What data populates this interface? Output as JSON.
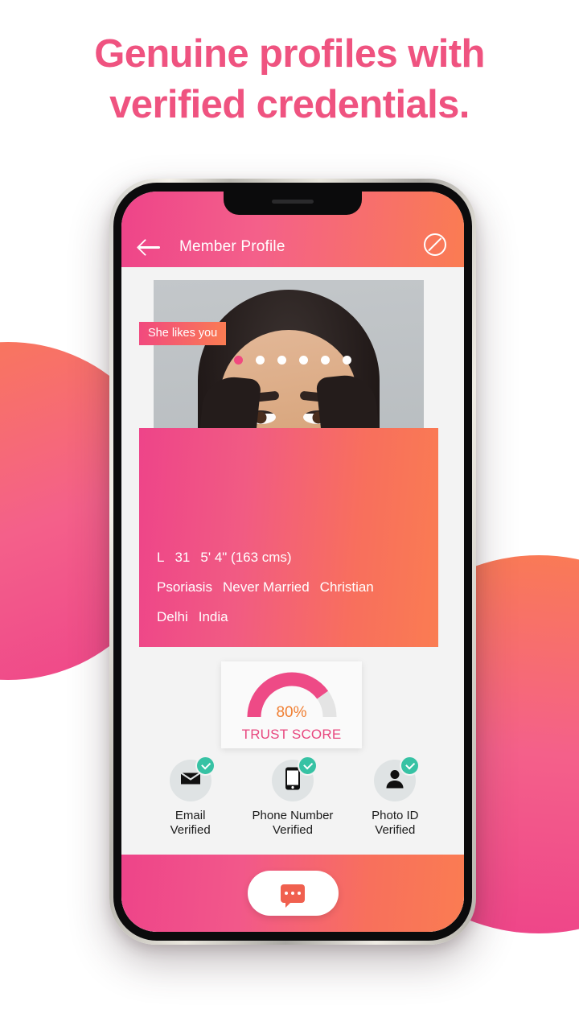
{
  "headline": {
    "line1": "Genuine profiles with",
    "line2": "verified credentials.",
    "color": "#EF5380"
  },
  "app": {
    "header": {
      "back_icon": "back-arrow-icon",
      "title": "Member Profile",
      "block_icon": "block-icon"
    },
    "photo": {
      "likes_badge": "She likes you",
      "dot_count": 6,
      "active_dot_index": 0
    },
    "profile": {
      "line1": {
        "id": "L",
        "age": "31",
        "height": "5' 4\" (163 cms)"
      },
      "line2": {
        "condition": "Psoriasis",
        "marital_status": "Never Married",
        "religion": "Christian"
      },
      "line3": {
        "city": "Delhi",
        "country": "India"
      }
    },
    "trust_score": {
      "value": "80%",
      "percent": 80,
      "label": "TRUST SCORE",
      "value_color": "#F07F32",
      "label_color": "#E8487F",
      "arc_color": "#EE4A86",
      "track_color": "#E4E4E4"
    },
    "verifications": [
      {
        "icon": "envelope-icon",
        "label_line1": "Email",
        "label_line2": "Verified",
        "status": "verified"
      },
      {
        "icon": "mobile-phone-icon",
        "label_line1": "Phone Number",
        "label_line2": "Verified",
        "status": "verified"
      },
      {
        "icon": "person-badge-icon",
        "label_line1": "Photo ID",
        "label_line2": "Verified",
        "status": "verified"
      }
    ],
    "bottom": {
      "chat_icon": "chat-bubble-icon"
    }
  },
  "theme": {
    "gradient_start": "#EE4489",
    "gradient_end": "#FA7C52",
    "check_green": "#37C2A4",
    "screen_bg": "#F3F3F3"
  }
}
